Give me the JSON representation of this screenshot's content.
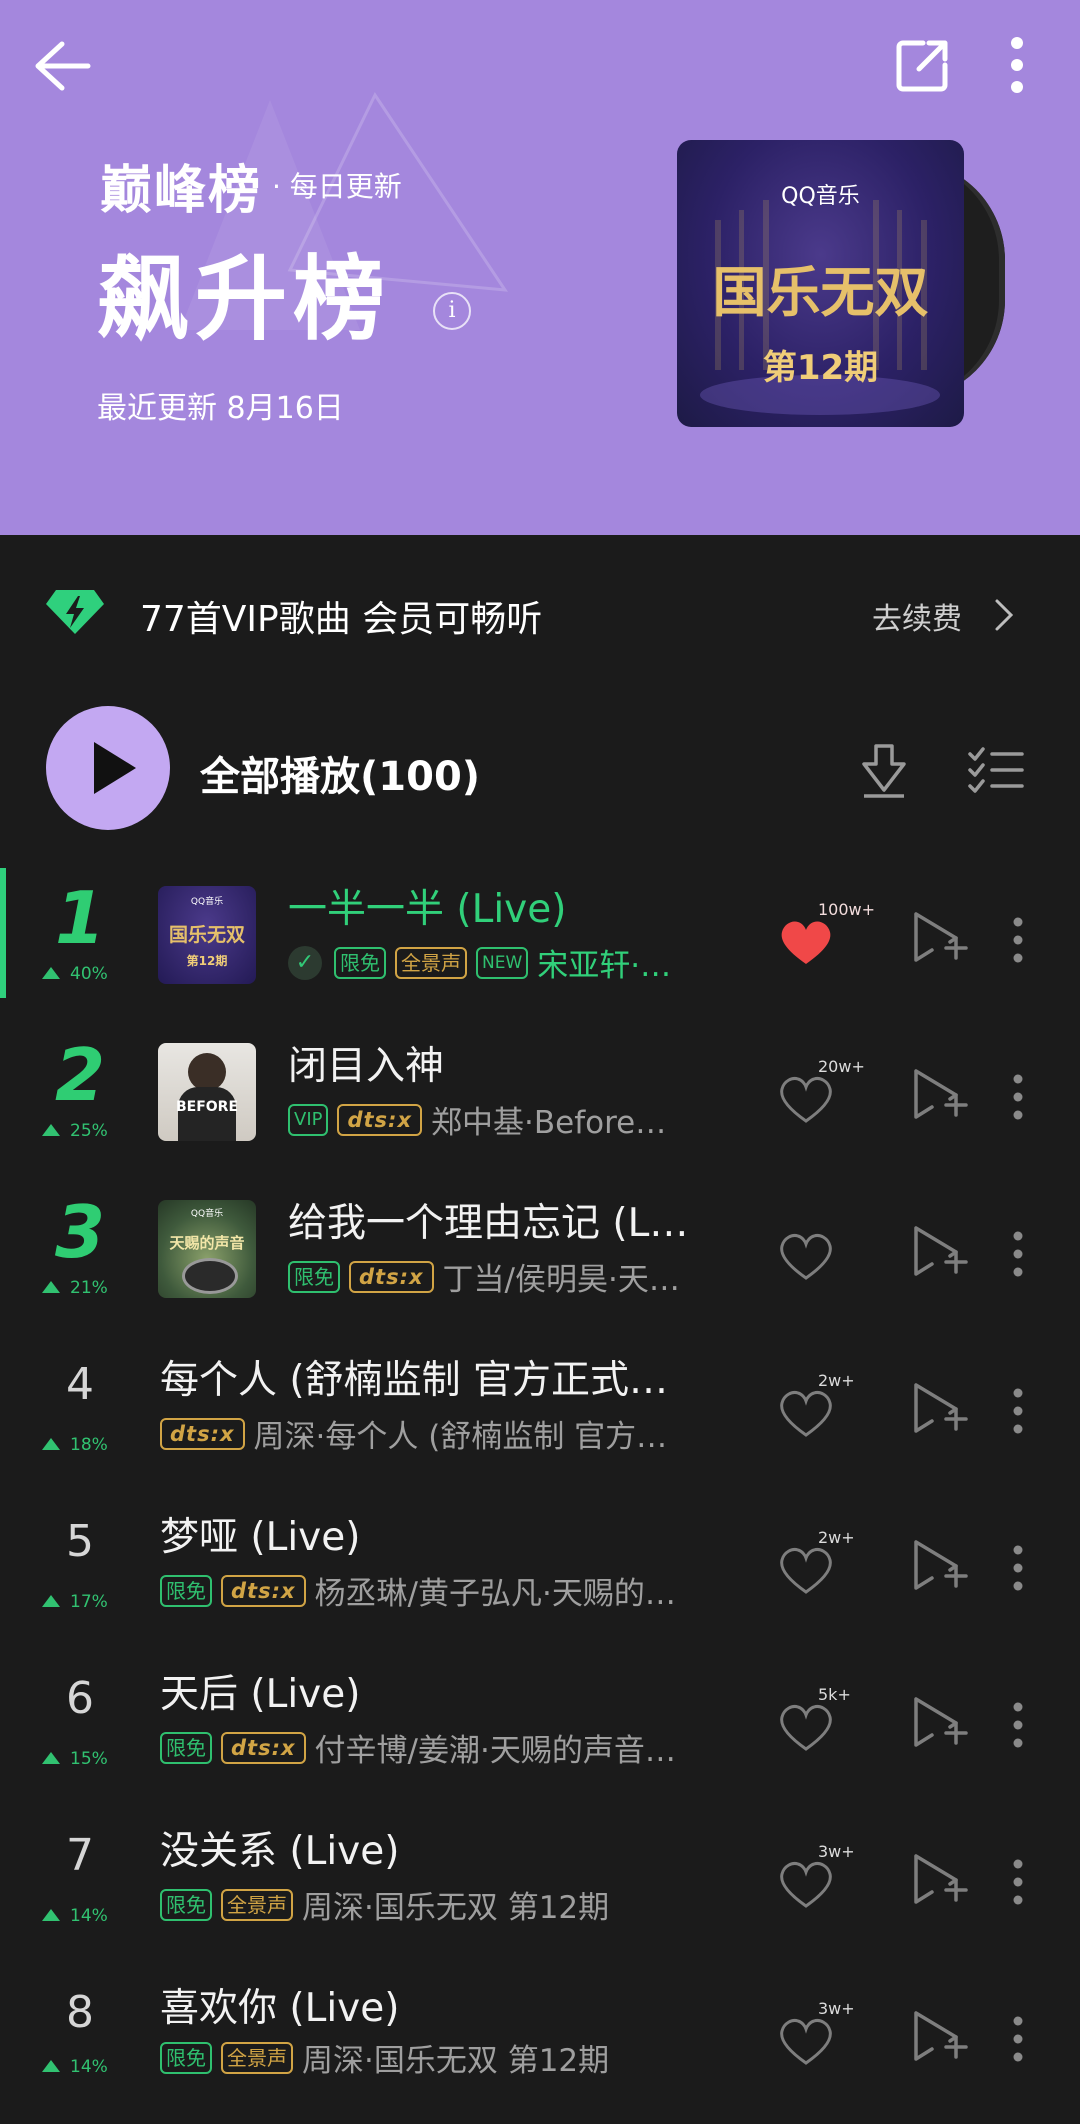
{
  "header": {
    "brand": "巅峰榜",
    "daily": "· 每日更新",
    "title": "飙升榜",
    "updated": "最近更新 8月16日",
    "info_icon": "i",
    "cover": {
      "logo": "QQ音乐",
      "title": "国乐无双",
      "issue": "第12期"
    },
    "bg_color": "#a487dd"
  },
  "vip": {
    "text": "77首VIP歌曲 会员可畅听",
    "renew": "去续费"
  },
  "play_all": {
    "label": "全部播放(100)"
  },
  "songs": [
    {
      "rank": "1",
      "trend": "40%",
      "title": "一半一半 (Live)",
      "meta": "宋亚轩·…",
      "likes": "100w+"
    },
    {
      "rank": "2",
      "trend": "25%",
      "title": "闭目入神",
      "meta": "郑中基·Before…",
      "likes": "20w+"
    },
    {
      "rank": "3",
      "trend": "21%",
      "title": "给我一个理由忘记 (L…",
      "meta": "丁当/侯明昊·天…",
      "likes": ""
    },
    {
      "rank": "4",
      "trend": "18%",
      "title": "每个人 (舒楠监制 官方正式…",
      "meta": "周深·每个人 (舒楠监制 官方…",
      "likes": "2w+"
    },
    {
      "rank": "5",
      "trend": "17%",
      "title": "梦哑 (Live)",
      "meta": "杨丞琳/黄子弘凡·天赐的…",
      "likes": "2w+"
    },
    {
      "rank": "6",
      "trend": "15%",
      "title": "天后 (Live)",
      "meta": "付辛博/姜潮·天赐的声音…",
      "likes": "5k+"
    },
    {
      "rank": "7",
      "trend": "14%",
      "title": "没关系 (Live)",
      "meta": "周深·国乐无双 第12期",
      "likes": "3w+"
    },
    {
      "rank": "8",
      "trend": "14%",
      "title": "喜欢你 (Live)",
      "meta": "周深·国乐无双 第12期",
      "likes": "3w+"
    }
  ],
  "tags": {
    "free": "限免",
    "spatial": "全景声",
    "new": "NEW",
    "vip": "VIP",
    "dts": "dts:x"
  },
  "thumbs": {
    "t1_logo": "QQ音乐",
    "t1_issue": "第12期",
    "t2_text": "BEFORE",
    "t3_logo": "QQ音乐",
    "t3_text": "天赐的声音"
  },
  "icons": [
    "back-arrow-icon",
    "share-icon",
    "more-vertical-icon",
    "diamond-bolt-icon",
    "chevron-right-icon",
    "play-icon",
    "download-icon",
    "multi-select-icon",
    "heart-icon",
    "add-to-playlist-icon"
  ],
  "colors": {
    "accent_green": "#2fcd73",
    "liked_red": "#f04848",
    "play_button": "#c3a8f2"
  }
}
